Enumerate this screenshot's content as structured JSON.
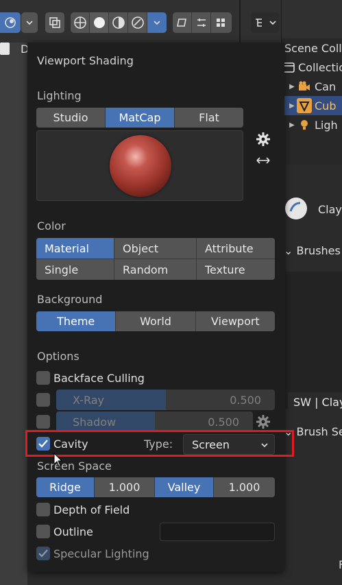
{
  "viewport": {
    "partial_label": "D"
  },
  "outliner": {
    "rows": [
      {
        "label": "Scene Colle",
        "icon": "scene-collection-icon"
      },
      {
        "label": "Collection",
        "icon": "collection-icon"
      },
      {
        "label": "Can",
        "icon": "camera-icon"
      },
      {
        "label": "Cub",
        "icon": "mesh-icon"
      },
      {
        "label": "Ligh",
        "icon": "light-icon"
      }
    ]
  },
  "properties": {
    "brush_name": "Clay",
    "brushes_label": "Brushes",
    "brush_field": "SW | Clay",
    "brush_settings_label": "Brush Se",
    "bottom_letter": "F"
  },
  "popover": {
    "title": "Viewport Shading",
    "lighting": {
      "label": "Lighting",
      "options": [
        "Studio",
        "MatCap",
        "Flat"
      ],
      "selected": "MatCap"
    },
    "color": {
      "label": "Color",
      "options": [
        "Material",
        "Object",
        "Attribute",
        "Single",
        "Random",
        "Texture"
      ],
      "selected": "Material"
    },
    "background": {
      "label": "Background",
      "options": [
        "Theme",
        "World",
        "Viewport"
      ],
      "selected": "Theme"
    },
    "options": {
      "label": "Options",
      "backface_culling": "Backface Culling",
      "xray": {
        "label": "X-Ray",
        "value": "0.500",
        "fraction": 0.5
      },
      "shadow": {
        "label": "Shadow",
        "value": "0.500",
        "fraction": 0.5
      },
      "cavity": "Cavity",
      "cavity_type_label": "Type:",
      "cavity_type_value": "Screen"
    },
    "screen_space": {
      "label": "Screen Space",
      "ridge_label": "Ridge",
      "ridge_value": "1.000",
      "valley_label": "Valley",
      "valley_value": "1.000"
    },
    "depth_of_field": "Depth of Field",
    "outline": "Outline",
    "specular_lighting": "Specular Lighting"
  },
  "colors": {
    "accent": "#4772b3",
    "highlight": "#e11b22",
    "panel": "#1e1e1e"
  }
}
